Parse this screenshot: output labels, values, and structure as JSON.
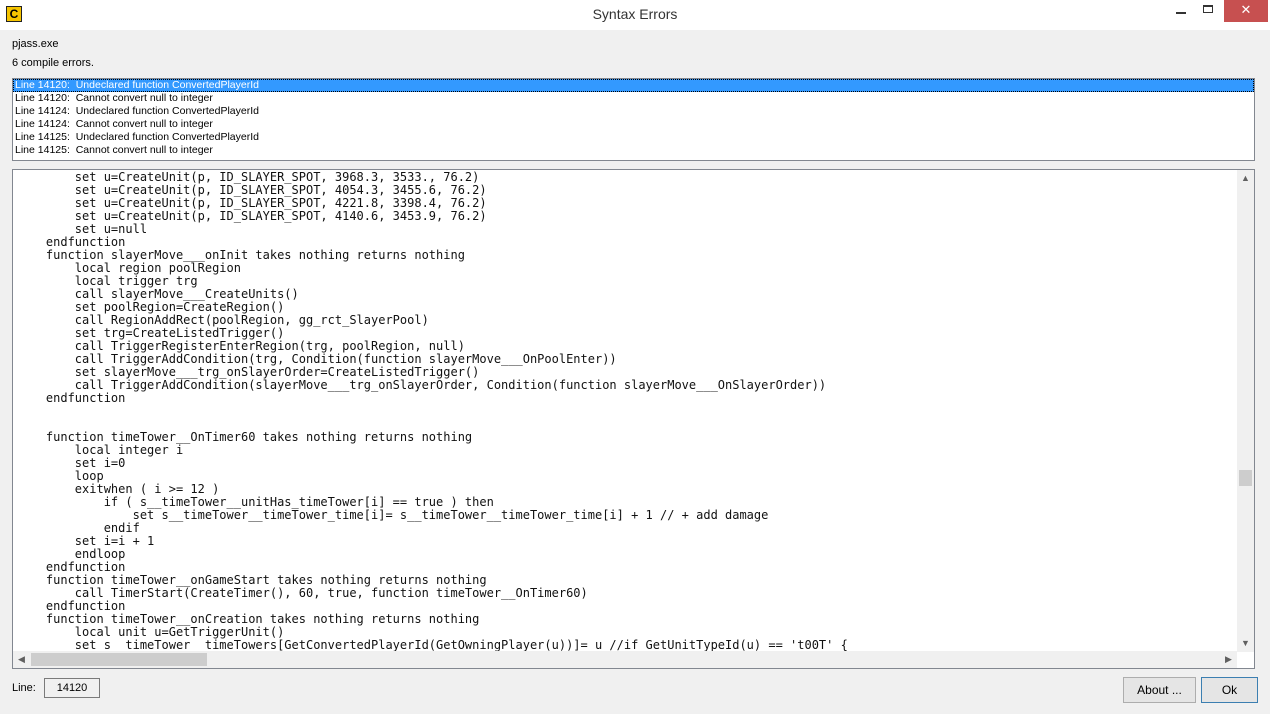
{
  "window": {
    "title": "Syntax Errors",
    "icon_letter": "C",
    "minimize": "—",
    "close": "✕"
  },
  "header": {
    "executable": "pjass.exe",
    "error_count": "6 compile errors."
  },
  "errors": [
    "Line 14120:  Undeclared function ConvertedPlayerId",
    "Line 14120:  Cannot convert null to integer",
    "Line 14124:  Undeclared function ConvertedPlayerId",
    "Line 14124:  Cannot convert null to integer",
    "Line 14125:  Undeclared function ConvertedPlayerId",
    "Line 14125:  Cannot convert null to integer"
  ],
  "code_lines": [
    "        set u=CreateUnit(p, ID_SLAYER_SPOT, 3968.3, 3533., 76.2)",
    "        set u=CreateUnit(p, ID_SLAYER_SPOT, 4054.3, 3455.6, 76.2)",
    "        set u=CreateUnit(p, ID_SLAYER_SPOT, 4221.8, 3398.4, 76.2)",
    "        set u=CreateUnit(p, ID_SLAYER_SPOT, 4140.6, 3453.9, 76.2)",
    "        set u=null",
    "    endfunction",
    "    function slayerMove___onInit takes nothing returns nothing",
    "        local region poolRegion",
    "        local trigger trg",
    "        call slayerMove___CreateUnits()",
    "        set poolRegion=CreateRegion()",
    "        call RegionAddRect(poolRegion, gg_rct_SlayerPool)",
    "        set trg=CreateListedTrigger()",
    "        call TriggerRegisterEnterRegion(trg, poolRegion, null)",
    "        call TriggerAddCondition(trg, Condition(function slayerMove___OnPoolEnter))",
    "        set slayerMove___trg_onSlayerOrder=CreateListedTrigger()",
    "        call TriggerAddCondition(slayerMove___trg_onSlayerOrder, Condition(function slayerMove___OnSlayerOrder))",
    "    endfunction",
    "",
    "",
    "    function timeTower__OnTimer60 takes nothing returns nothing",
    "        local integer i",
    "        set i=0",
    "        loop",
    "        exitwhen ( i >= 12 )",
    "            if ( s__timeTower__unitHas_timeTower[i] == true ) then",
    "                set s__timeTower__timeTower_time[i]= s__timeTower__timeTower_time[i] + 1 // + add damage",
    "            endif",
    "        set i=i + 1",
    "        endloop",
    "    endfunction",
    "    function timeTower__onGameStart takes nothing returns nothing",
    "        call TimerStart(CreateTimer(), 60, true, function timeTower__OnTimer60)",
    "    endfunction",
    "    function timeTower__onCreation takes nothing returns nothing",
    "        local unit u=GetTriggerUnit()",
    "        set s__timeTower__timeTowers[GetConvertedPlayerId(GetOwningPlayer(u))]= u //if GetUnitTypeId(u) == 't00T' {"
  ],
  "footer": {
    "line_label": "Line:",
    "line_value": "14120",
    "about_button": "About ...",
    "ok_button": "Ok"
  }
}
